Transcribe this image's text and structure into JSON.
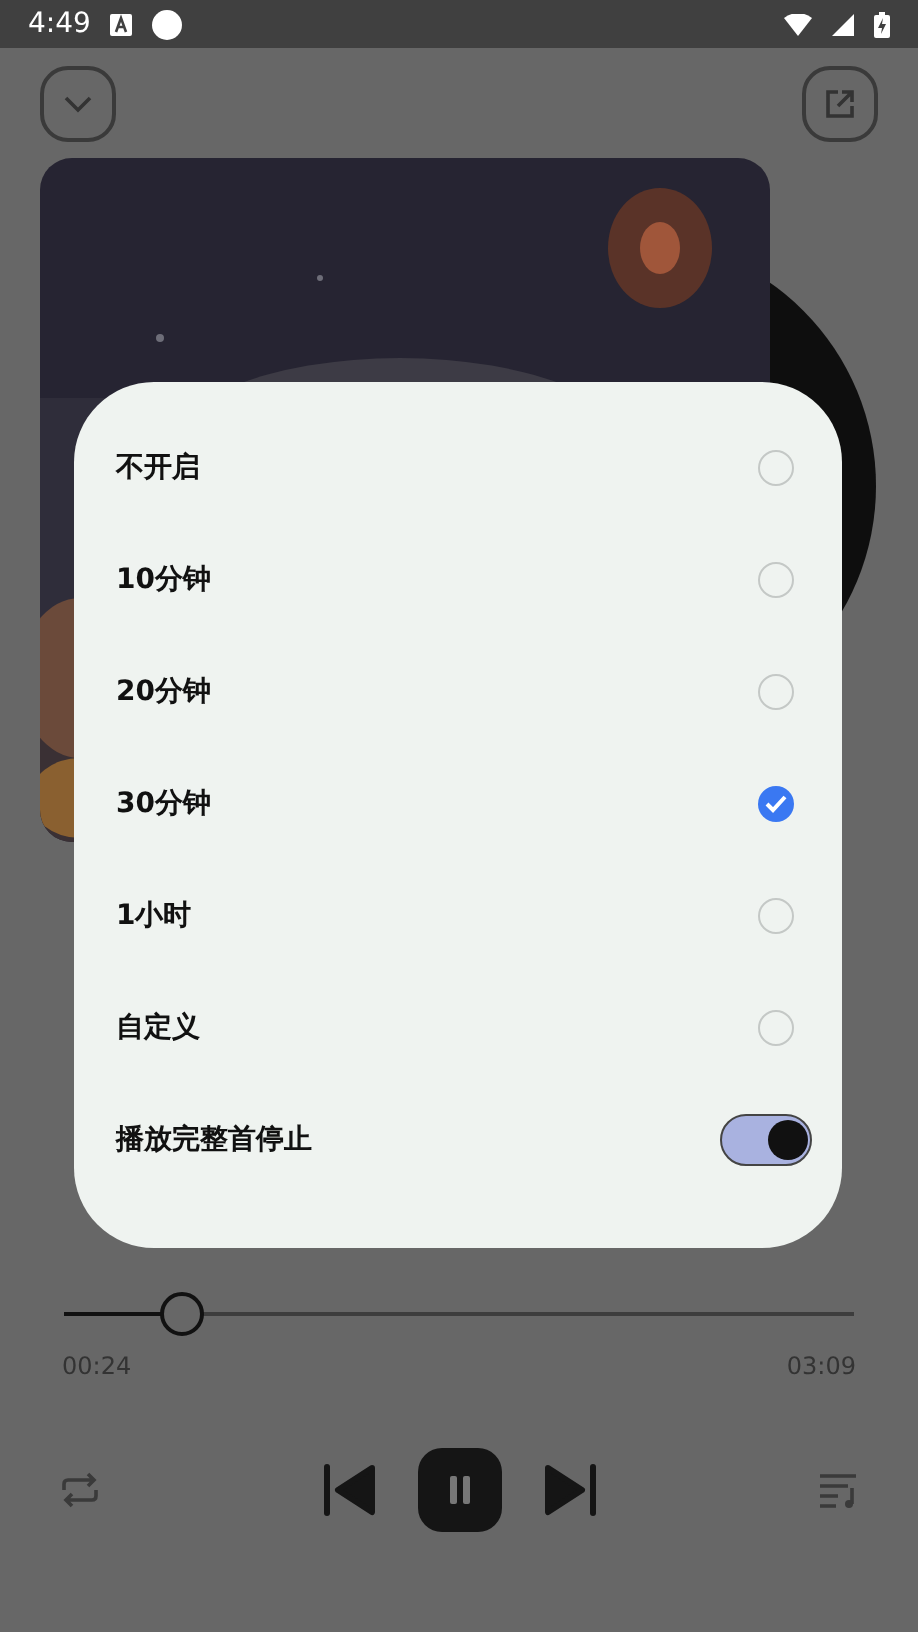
{
  "status_bar": {
    "time": "4:49"
  },
  "player": {
    "progress": {
      "level": 0.15
    },
    "elapsed": "00:24",
    "duration": "03:09"
  },
  "sleep_timer_dialog": {
    "options": [
      {
        "kind": "radio",
        "label": "不开启",
        "selected": false
      },
      {
        "kind": "radio",
        "label": "10分钟",
        "selected": false
      },
      {
        "kind": "radio",
        "label": "20分钟",
        "selected": false
      },
      {
        "kind": "radio",
        "label": "30分钟",
        "selected": true
      },
      {
        "kind": "radio",
        "label": "1小时",
        "selected": false
      },
      {
        "kind": "radio",
        "label": "自定义",
        "selected": false
      },
      {
        "kind": "switch",
        "label": "播放完整首停止",
        "on": true
      }
    ]
  }
}
